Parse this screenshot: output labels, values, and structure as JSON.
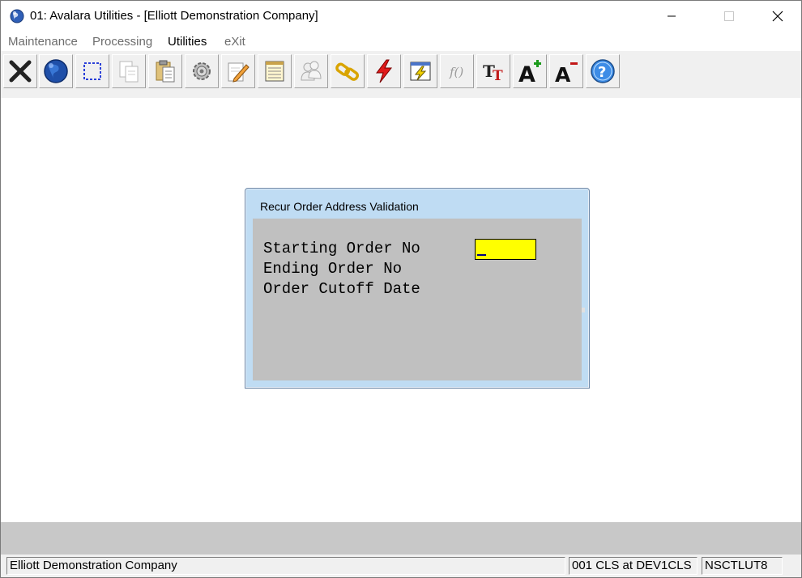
{
  "window": {
    "title": "01: Avalara Utilities - [Elliott Demonstration Company]",
    "app_icon": "globe-icon",
    "controls": {
      "minimize": "minimize-icon",
      "maximize": "maximize-icon",
      "close": "close-icon"
    }
  },
  "menu": {
    "items": [
      {
        "label": "Maintenance",
        "active": false
      },
      {
        "label": "Processing",
        "active": false
      },
      {
        "label": "Utilities",
        "active": true
      },
      {
        "label": "eXit",
        "active": false
      }
    ]
  },
  "toolbar": {
    "buttons": [
      {
        "icon": "exit-x-icon"
      },
      {
        "icon": "globe-icon"
      },
      {
        "icon": "select-rect-icon"
      },
      {
        "icon": "copy-icon"
      },
      {
        "icon": "paste-icon"
      },
      {
        "icon": "settings-gear-icon"
      },
      {
        "icon": "edit-pencil-icon"
      },
      {
        "icon": "notepad-icon"
      },
      {
        "icon": "users-icon"
      },
      {
        "icon": "chain-link-icon"
      },
      {
        "icon": "lightning-icon"
      },
      {
        "icon": "screen-lightning-icon"
      },
      {
        "icon": "function-icon"
      },
      {
        "icon": "text-size-icon"
      },
      {
        "icon": "font-increase-icon"
      },
      {
        "icon": "font-decrease-icon"
      },
      {
        "icon": "help-icon"
      }
    ]
  },
  "dialog": {
    "title": "Recur Order Address Validation",
    "fields": [
      {
        "label": "Starting Order No",
        "value": ""
      },
      {
        "label": "Ending Order No"
      },
      {
        "label": "Order Cutoff Date"
      }
    ]
  },
  "status": {
    "company": "Elliott Demonstration Company",
    "session": "001 CLS at DEV1CLS",
    "program": "NSCTLUT8"
  },
  "colors": {
    "input_highlight": "#ffff00",
    "dialog_frame": "#bfdcf3",
    "dialog_body": "#c0c0c0"
  }
}
